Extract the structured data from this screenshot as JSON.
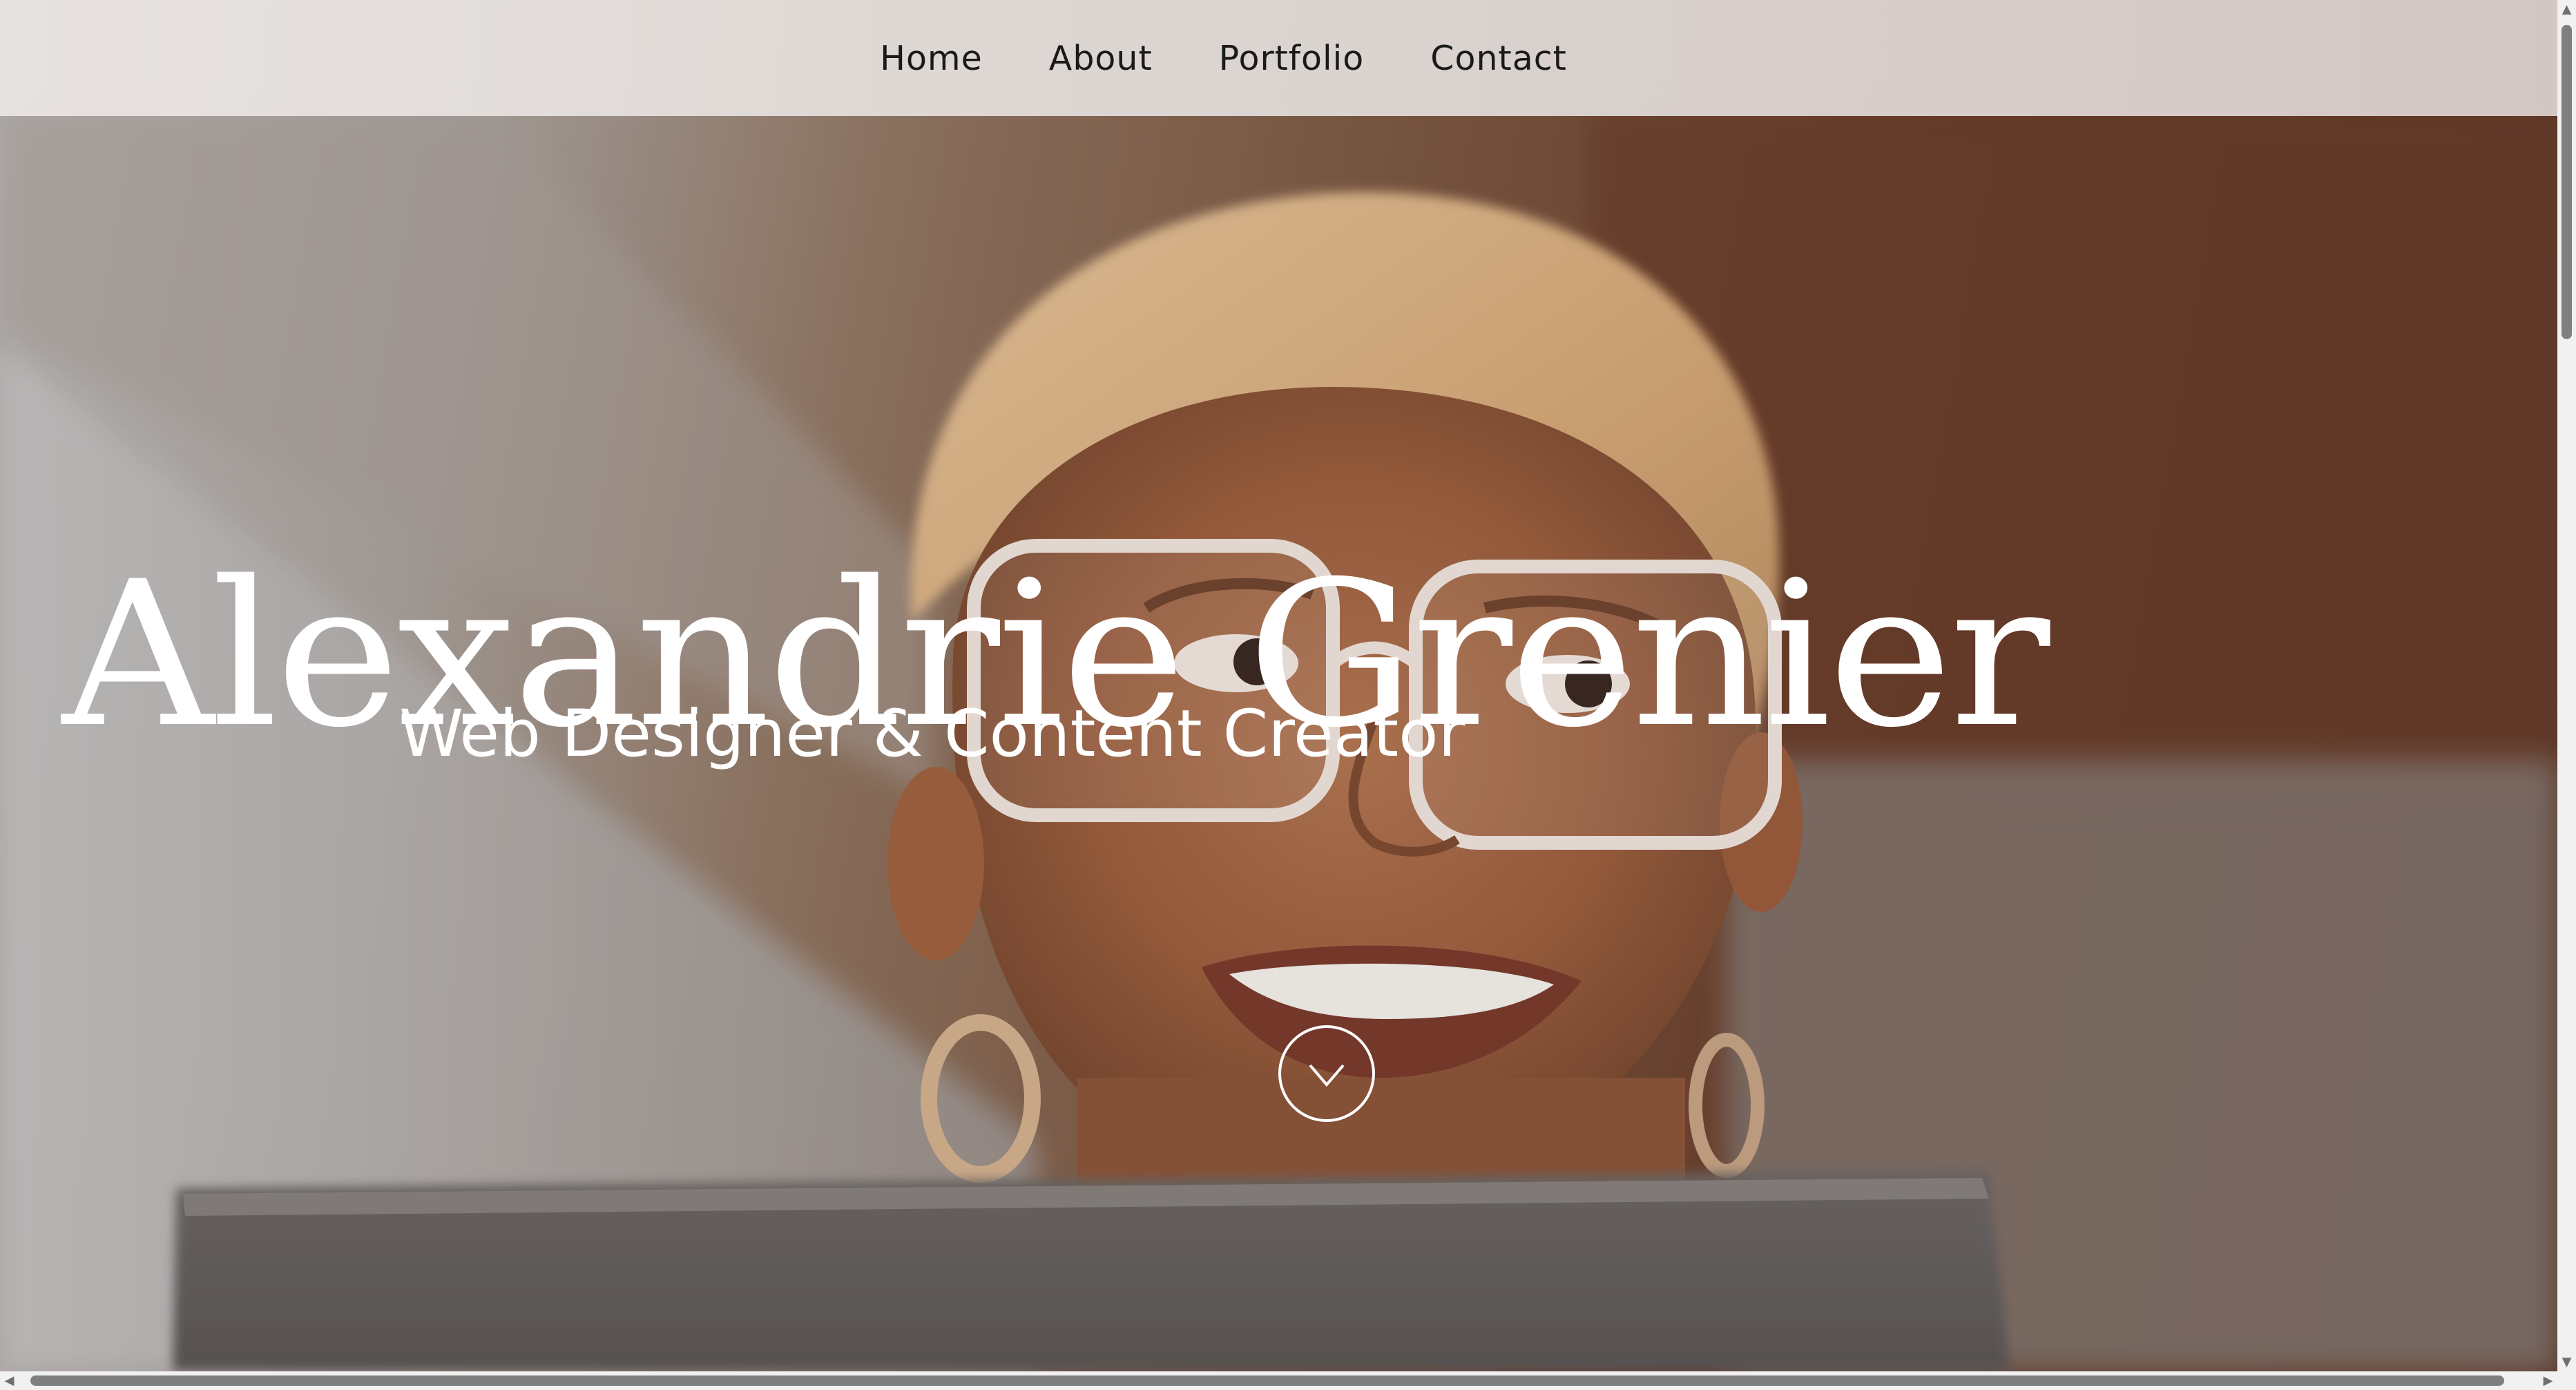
{
  "nav": {
    "items": [
      {
        "label": "Home"
      },
      {
        "label": "About"
      },
      {
        "label": "Portfolio"
      },
      {
        "label": "Contact"
      }
    ]
  },
  "hero": {
    "name": "Alexandrie Grenier",
    "subtitle": "Web Designer & Content Creator",
    "scroll_icon": "chevron-down-icon",
    "background_photo": "smiling-woman-with-glasses-photo"
  },
  "colors": {
    "text_on_hero": "#ffffff",
    "nav_text": "#1a1a1a",
    "nav_background": "#e3dedb"
  }
}
